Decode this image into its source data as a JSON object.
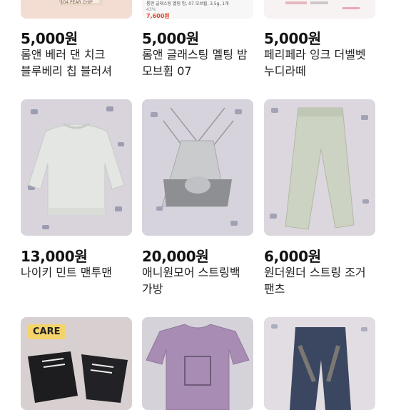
{
  "products": [
    {
      "price": "5,000원",
      "title": "롬앤 베러 댄 치크 블루베리 칩 블러셔",
      "badge": "",
      "thumb_text": [
        "'104 PEAR CHIP"
      ]
    },
    {
      "price": "5,000원",
      "title": "롬앤 글래스팅 멜팅 밤 모브휩 07",
      "badge": "",
      "thumb_text": [
        "롬앤 글래스팅 멜팅 밤, 07 모브휩, 3.5g, 1개",
        "43%",
        "7,600원"
      ]
    },
    {
      "price": "5,000원",
      "title": "페리페라 잉크 더벨벳 누디라떼",
      "badge": "",
      "thumb_text": []
    },
    {
      "price": "13,000원",
      "title": "나이키 민트 맨투맨",
      "badge": "",
      "thumb_text": []
    },
    {
      "price": "20,000원",
      "title": "애니원모어 스트링백 가방",
      "badge": "",
      "thumb_text": []
    },
    {
      "price": "6,000원",
      "title": "원더원더 스트링 조거 팬츠",
      "badge": "",
      "thumb_text": []
    },
    {
      "price": "",
      "title": "",
      "badge": "CARE",
      "thumb_text": []
    },
    {
      "price": "",
      "title": "",
      "badge": "",
      "thumb_text": []
    },
    {
      "price": "",
      "title": "",
      "badge": "",
      "thumb_text": []
    }
  ]
}
